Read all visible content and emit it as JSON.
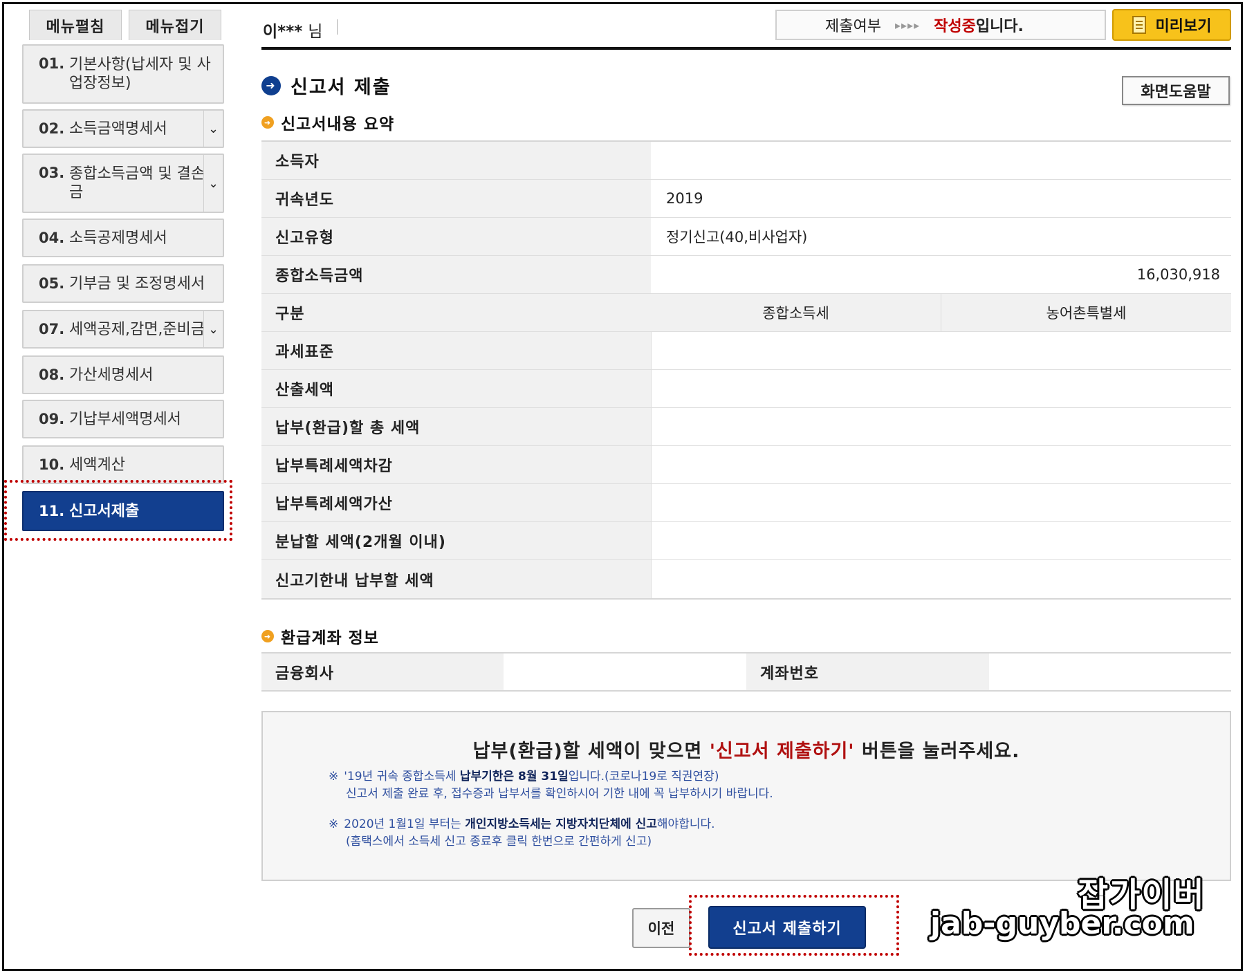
{
  "sidebar": {
    "top_buttons": {
      "edit": "메뉴펼침",
      "fold": "메뉴접기"
    },
    "items": [
      {
        "num": "01.",
        "label": "기본사항(납세자 및 사업장정보)"
      },
      {
        "num": "02.",
        "label": "소득금액명세서"
      },
      {
        "num": "03.",
        "label": "종합소득금액 및 결손금"
      },
      {
        "num": "04.",
        "label": "소득공제명세서"
      },
      {
        "num": "05.",
        "label": "기부금 및 조정명세서"
      },
      {
        "num": "07.",
        "label": "세액공제,감면,준비금"
      },
      {
        "num": "08.",
        "label": "가산세명세서"
      },
      {
        "num": "09.",
        "label": "기납부세액명세서"
      },
      {
        "num": "10.",
        "label": "세액계산"
      },
      {
        "num": "11.",
        "label": "신고서제출"
      }
    ]
  },
  "header": {
    "user_name": "이***",
    "user_suffix": "님",
    "status_label": "제출여부",
    "status_arrows": "▸▸▸▸",
    "status_value": "작성중",
    "status_tail": "입니다.",
    "preview": "미리보기"
  },
  "page": {
    "title": "신고서 제출",
    "help": "화면도움말",
    "summary_title": "신고서내용 요약",
    "refund_title": "환급계좌 정보"
  },
  "summary": {
    "income_earner_label": "소득자",
    "income_earner_value": "",
    "year_label": "귀속년도",
    "year_value": "2019",
    "type_label": "신고유형",
    "type_value": "정기신고(40,비사업자)",
    "total_income_label": "종합소득금액",
    "total_income_value": "16,030,918",
    "division_label": "구분",
    "col_income_tax": "종합소득세",
    "col_rural_tax": "농어촌특별세",
    "rows": [
      "과세표준",
      "산출세액",
      "납부(환급)할 총 세액",
      "납부특례세액차감",
      "납부특례세액가산",
      "분납할 세액(2개월 이내)",
      "신고기한내 납부할 세액"
    ]
  },
  "refund": {
    "bank_label": "금융회사",
    "account_label": "계좌번호"
  },
  "notice": {
    "main_pre": "납부(환급)할 세액이 맞으면 ",
    "main_hl": "'신고서 제출하기'",
    "main_post": " 버튼을 눌러주세요.",
    "star": "※",
    "n1_a": "'19년 귀속 종합소득세 ",
    "n1_b": "납부기한은 8월 31일",
    "n1_c": "입니다.(코로나19로 직권연장)",
    "n1_line2": "신고서 제출 완료 후, 접수증과 납부서를 확인하시어 기한 내에 꼭 납부하시기 바랍니다.",
    "n2_a": "2020년 1월1일 부터는 ",
    "n2_b": "개인지방소득세는 지방자치단체에 신고",
    "n2_c": "해야합니다.",
    "n2_line2": "(홈택스에서 소득세 신고 종료후 클릭 한번으로 간편하게 신고)"
  },
  "buttons": {
    "prev": "이전",
    "submit": "신고서 제출하기"
  },
  "watermark": {
    "line1": "잡가이버",
    "line2": "jab-guyber.com"
  },
  "colors": {
    "primary_navy": "#123f8f",
    "highlight_red": "#c00000",
    "preview_yellow": "#f7c21b",
    "bullet_orange": "#f0a020"
  }
}
